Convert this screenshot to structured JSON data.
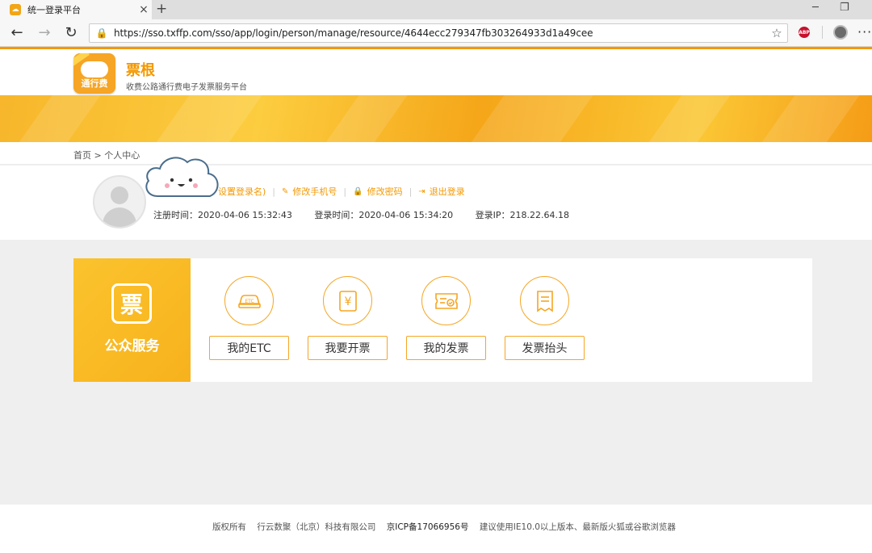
{
  "browser": {
    "tab_title": "统一登录平台",
    "tab_close": "×",
    "new_tab": "+",
    "url": "https://sso.txffp.com/sso/app/login/person/manage/resource/4644ecc279347fb303264933d1a49cee",
    "back": "←",
    "forward": "→",
    "refresh": "↻",
    "lock": "🔒",
    "star": "☆",
    "abp": "ABP",
    "more": "···",
    "minimize": "─",
    "restore": "❐"
  },
  "header": {
    "logo_text": "通行费",
    "brand_name": "票根",
    "brand_sub": "收费公路通行费电子发票服务平台"
  },
  "breadcrumb": {
    "text": "首页 > 个人中心"
  },
  "profile": {
    "username_hint": "设置登录名)",
    "actions": [
      {
        "icon": "✎",
        "label": "修改手机号"
      },
      {
        "icon": "🔒",
        "label": "修改密码"
      },
      {
        "icon": "⇥",
        "label": "退出登录"
      }
    ],
    "separator": "|",
    "register_time": "注册时间：2020-04-06 15:32:43",
    "login_time": "登录时间：2020-04-06 15:34:20",
    "login_ip": "登录IP：218.22.64.18"
  },
  "services": {
    "icon_char": "票",
    "title": "公众服务",
    "items": [
      {
        "label": "我的ETC",
        "icon_text": "ETC"
      },
      {
        "label": "我要开票",
        "icon_text": "¥"
      },
      {
        "label": "我的发票",
        "icon_text": ""
      },
      {
        "label": "发票抬头",
        "icon_text": ""
      }
    ]
  },
  "footer": {
    "copyright": "版权所有",
    "company": "行云数聚（北京）科技有限公司",
    "icp": "京ICP备17066956号",
    "suggestion": "建议使用IE10.0以上版本、最新版火狐或谷歌浏览器"
  },
  "colors": {
    "accent": "#f39800",
    "service_yellow": "#f7b21c",
    "border_orange": "#f5a623"
  }
}
